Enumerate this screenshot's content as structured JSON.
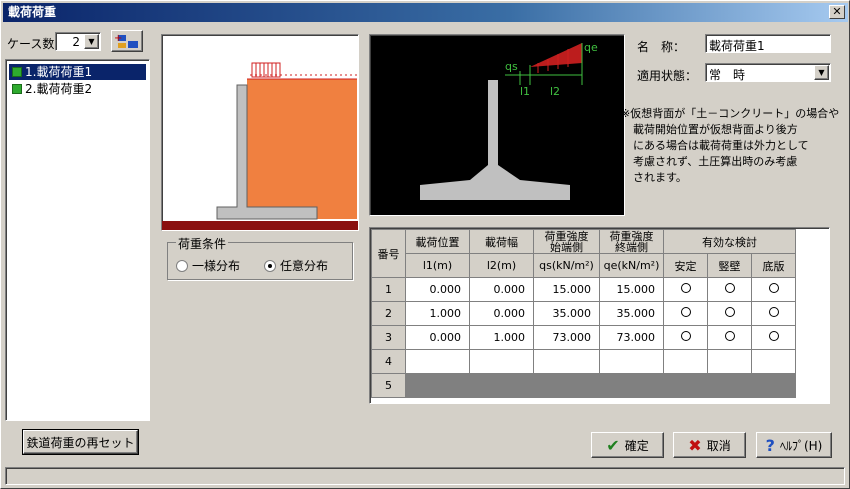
{
  "window": {
    "title": "載荷荷重"
  },
  "case_count": {
    "label": "ケース数:",
    "value": "2"
  },
  "cases": [
    {
      "label": "1.載荷荷重1",
      "selected": true
    },
    {
      "label": "2.載荷荷重2",
      "selected": false
    }
  ],
  "schematic": {
    "labels": {
      "qs": "qs",
      "qe": "qe",
      "l1": "l1",
      "l2": "l2"
    }
  },
  "load_condition": {
    "caption": "荷重条件",
    "options": [
      "一様分布",
      "任意分布"
    ],
    "selected": "任意分布"
  },
  "name_field": {
    "label": "名　称：",
    "value": "載荷荷重1"
  },
  "state_field": {
    "label": "適用状態：",
    "value": "常　時"
  },
  "note": {
    "lines": [
      "※仮想背面が「土－コンクリート」の場合や",
      "載荷開始位置が仮想背面より後方",
      "にある場合は載荷荷重は外力として",
      "考慮されず、土圧算出時のみ考慮",
      "されます。"
    ]
  },
  "table": {
    "headers": {
      "no": "番号",
      "pos": "載荷位置",
      "pos_unit": "l1(m)",
      "width": "載荷幅",
      "width_unit": "l2(m)",
      "qs": "荷重強度",
      "qs2": "始端側",
      "qs_unit": "qs(kN/m²)",
      "qe": "荷重強度",
      "qe2": "終端側",
      "qe_unit": "qe(kN/m²)",
      "check": "有効な検討",
      "c1": "安定",
      "c2": "竪壁",
      "c3": "底版"
    },
    "rows": [
      {
        "no": "1",
        "pos": "0.000",
        "width": "0.000",
        "qs": "15.000",
        "qe": "15.000"
      },
      {
        "no": "2",
        "pos": "1.000",
        "width": "0.000",
        "qs": "35.000",
        "qe": "35.000"
      },
      {
        "no": "3",
        "pos": "0.000",
        "width": "1.000",
        "qs": "73.000",
        "qe": "73.000"
      },
      {
        "no": "4",
        "pos": "",
        "width": "",
        "qs": "",
        "qe": ""
      },
      {
        "no": "5",
        "pos": "",
        "width": "",
        "qs": "",
        "qe": ""
      }
    ]
  },
  "buttons": {
    "reset": "鉄道荷重の再セット",
    "ok": "確定",
    "cancel": "取消",
    "help": "ﾍﾙﾌﾟ(H)"
  },
  "colors": {
    "soil": "#f08040",
    "concrete": "#c0c0c0",
    "load": "#d02020"
  }
}
